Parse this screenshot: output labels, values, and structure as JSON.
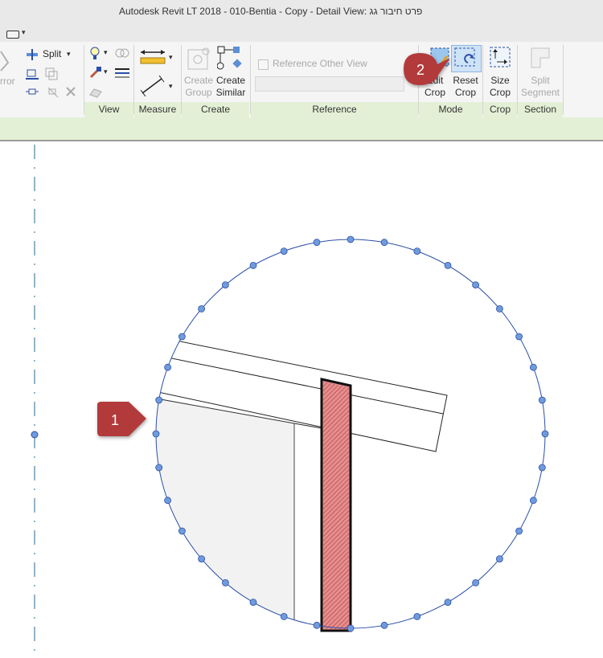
{
  "window": {
    "title": "Autodesk Revit LT 2018 -     010-Bentia - Copy - Detail View: פרט חיבור גג"
  },
  "ribbon": {
    "modify_panel": {
      "split_label": "Split",
      "mirror_label": "rror"
    },
    "view_panel": {
      "label": "View"
    },
    "measure_panel": {
      "label": "Measure"
    },
    "create_panel": {
      "label": "Create",
      "create_group_label": [
        "Create",
        "Group"
      ],
      "create_similar_label": [
        "Create",
        "Similar"
      ]
    },
    "reference_panel": {
      "label": "Reference",
      "reference_other_view_label": "Reference Other View",
      "reference_other_view_checked": false
    },
    "mode_panel": {
      "label": "Mode",
      "edit_crop_label": [
        "Edit",
        "Crop"
      ],
      "reset_crop_label": [
        "Reset",
        "Crop"
      ]
    },
    "crop_panel": {
      "label": "Crop",
      "size_crop_label": [
        "Size",
        "Crop"
      ]
    },
    "section_panel": {
      "label": "Section",
      "split_segment_label": [
        "Split",
        "Segment"
      ]
    }
  },
  "callouts": [
    {
      "number": "1",
      "target": "crop-region-boundary"
    },
    {
      "number": "2",
      "target": "reset-crop-button"
    }
  ],
  "colors": {
    "ribbon_panel_label_bg": "#e4f0d6",
    "crop_boundary": "#2b4fa8",
    "grip": "#6f9bdc",
    "callout": "#b33a3a",
    "cut_section_fill": "#e58f8f"
  },
  "icons": [
    "split-icon",
    "bulb-icon",
    "paint-brush-icon",
    "measure-icon",
    "create-similar-icon",
    "edit-crop-icon",
    "reset-crop-icon",
    "size-crop-icon",
    "split-segment-icon"
  ]
}
